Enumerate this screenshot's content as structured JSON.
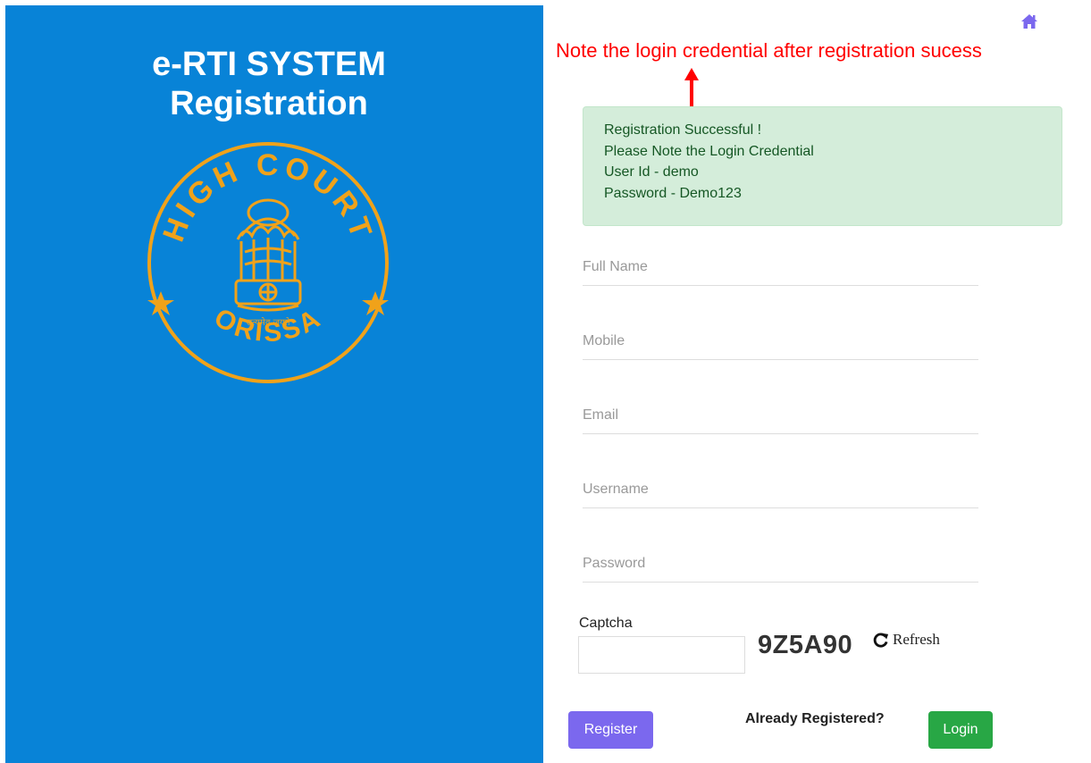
{
  "brand": {
    "title_line1": "e-RTI SYSTEM",
    "title_line2": "Registration"
  },
  "seal": {
    "top_text": "HIGH COURT",
    "bottom_text": "ORISSA",
    "motto": "सत्यमेव जयते",
    "color": "#f0a21a"
  },
  "annotation": {
    "note": "Note the login credential after registration sucess",
    "color": "#ff0000"
  },
  "alert": {
    "line1": "Registration Successful !",
    "line2": "Please Note the Login Credential",
    "line3": "User Id - demo",
    "line4": "Password - Demo123"
  },
  "form": {
    "full_name_placeholder": "Full Name",
    "mobile_placeholder": "Mobile",
    "email_placeholder": "Email",
    "username_placeholder": "Username",
    "password_placeholder": "Password",
    "captcha_label": "Captcha",
    "captcha_code": "9Z5A90",
    "refresh_label": "Refresh"
  },
  "actions": {
    "register_label": "Register",
    "already_registered": "Already Registered?",
    "login_label": "Login"
  },
  "icons": {
    "home": "home-icon",
    "refresh": "refresh-icon",
    "emblem": "emblem-icon"
  },
  "colors": {
    "panel_blue": "#0883d7",
    "register_purple": "#7b68ee",
    "login_green": "#28a745",
    "alert_bg": "#d4edda",
    "alert_text": "#155724"
  }
}
